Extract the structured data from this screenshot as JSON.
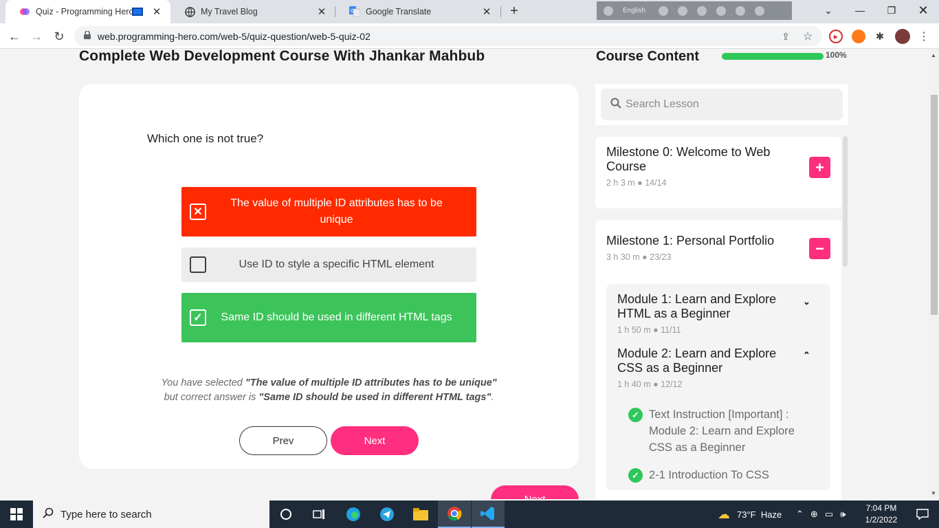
{
  "browser": {
    "tabs": [
      {
        "title": "Quiz - Programming Hero",
        "active": true
      },
      {
        "title": "My Travel Blog",
        "active": false
      },
      {
        "title": "Google Translate",
        "active": false
      }
    ],
    "language_bar": "English",
    "url": "web.programming-hero.com/web-5/quiz-question/web-5-quiz-02"
  },
  "page": {
    "course_title": "Complete Web Development Course With Jhankar Mahbub",
    "quiz": {
      "question": "Which one is not true?",
      "options": [
        {
          "text": "The value of multiple ID attributes has to be unique",
          "state": "wrong"
        },
        {
          "text": "Use ID to style a specific HTML element",
          "state": "unselected"
        },
        {
          "text": "Same ID should be used in different HTML tags",
          "state": "correct"
        }
      ],
      "feedback": {
        "prefix": "You have selected ",
        "selected": "\"The value of multiple ID attributes has to be unique\"",
        "middle": "but correct answer is ",
        "correct": "\"Same ID should be used in different HTML tags\"",
        "suffix": "."
      },
      "prev_label": "Prev",
      "next_label": "Next"
    },
    "bottom_next_label": "Next"
  },
  "sidebar": {
    "title": "Course Content",
    "progress_percent": 100,
    "progress_label": "100%",
    "search_placeholder": "Search Lesson",
    "milestones": [
      {
        "title": "Milestone 0: Welcome to Web Course",
        "duration": "2 h 3 m",
        "count": "14/14",
        "expanded": false,
        "toggle": "+"
      },
      {
        "title": "Milestone 1: Personal Portfolio",
        "duration": "3 h 30 m",
        "count": "23/23",
        "expanded": true,
        "toggle": "−"
      }
    ],
    "modules": [
      {
        "title": "Module 1: Learn and Explore HTML as a Beginner",
        "duration": "1 h 50 m",
        "count": "11/11",
        "expanded": false
      },
      {
        "title": "Module 2: Learn and Explore CSS as a Beginner",
        "duration": "1 h 40 m",
        "count": "12/12",
        "expanded": true
      }
    ],
    "lessons": [
      {
        "title": "Text Instruction [Important] : Module 2: Learn and Explore CSS as a Beginner",
        "done": true
      },
      {
        "title": "2-1 Introduction To CSS",
        "done": true
      }
    ]
  },
  "taskbar": {
    "search_placeholder": "Type here to search",
    "weather": "73°F  Haze",
    "time": "7:04 PM",
    "date": "1/2/2022"
  },
  "colors": {
    "accent_pink": "#ff2e7e",
    "wrong_red": "#ff2a00",
    "correct_green": "#3cc45a",
    "progress_green": "#2ec75a"
  }
}
